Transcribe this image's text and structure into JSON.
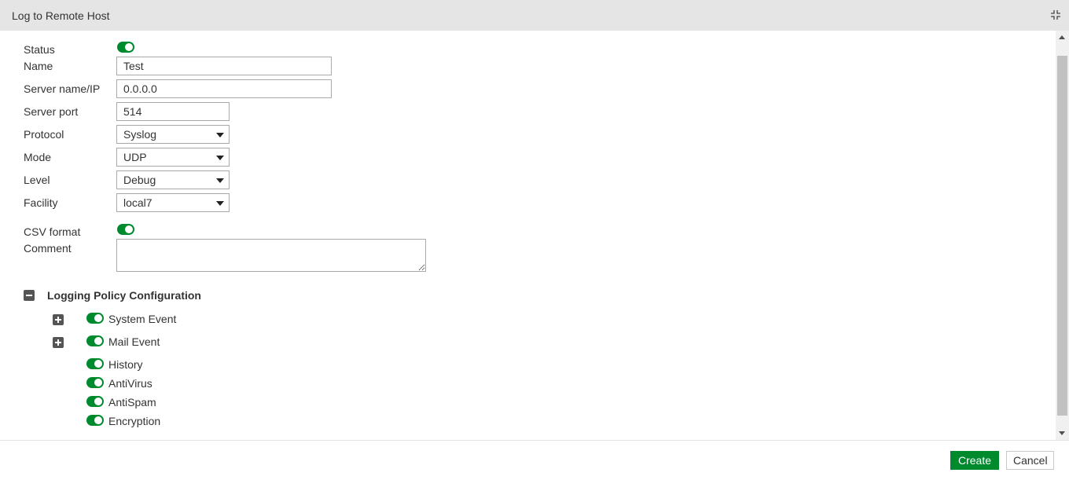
{
  "window": {
    "title": "Log to Remote Host",
    "collapse_icon": "collapse-icon"
  },
  "form": {
    "status": {
      "label": "Status",
      "enabled": true
    },
    "name": {
      "label": "Name",
      "value": "Test"
    },
    "server": {
      "label": "Server name/IP",
      "value": "0.0.0.0"
    },
    "port": {
      "label": "Server port",
      "value": "514"
    },
    "protocol": {
      "label": "Protocol",
      "value": "Syslog"
    },
    "mode": {
      "label": "Mode",
      "value": "UDP"
    },
    "level": {
      "label": "Level",
      "value": "Debug"
    },
    "facility": {
      "label": "Facility",
      "value": "local7"
    },
    "csv": {
      "label": "CSV format",
      "enabled": true
    },
    "comment": {
      "label": "Comment",
      "value": ""
    }
  },
  "policy": {
    "title": "Logging Policy Configuration",
    "expanded": true,
    "items": [
      {
        "label": "System Event",
        "enabled": true,
        "expandable": true
      },
      {
        "label": "Mail Event",
        "enabled": true,
        "expandable": true
      },
      {
        "label": "History",
        "enabled": true,
        "expandable": false
      },
      {
        "label": "AntiVirus",
        "enabled": true,
        "expandable": false
      },
      {
        "label": "AntiSpam",
        "enabled": true,
        "expandable": false
      },
      {
        "label": "Encryption",
        "enabled": true,
        "expandable": false
      }
    ]
  },
  "footer": {
    "create_label": "Create",
    "cancel_label": "Cancel"
  },
  "colors": {
    "accent": "#008a2e",
    "header_bg": "#e5e5e5"
  }
}
